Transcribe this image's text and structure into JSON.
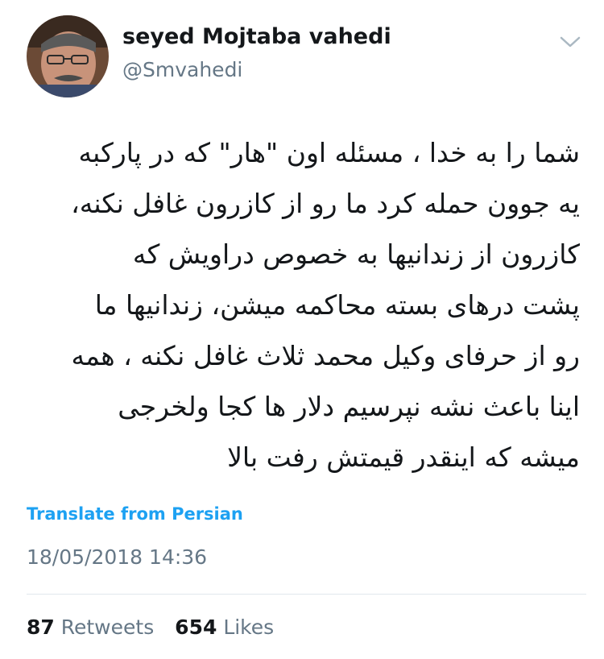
{
  "user": {
    "display_name": "seyed Mojtaba vahedi",
    "handle": "@Smvahedi"
  },
  "tweet": {
    "lines": [
      "شما را به خدا ، مسئله اون \"هار\" که در پارکبه",
      "یه جوون حمله کرد ما رو از کازرون غافل نکنه،",
      "کازرون از زندانیها به خصوص دراویش که",
      "پشت درهای بسته محاکمه میشن، زندانیها ما",
      "رو از حرفای وکیل محمد ثلاث غافل نکنه ، همه",
      "اینا باعث نشه نپرسیم دلار ها کجا ولخرجی",
      "میشه که اینقدر قیمتش رفت بالا"
    ],
    "translate_label": "Translate from Persian",
    "timestamp": "18/05/2018 14:36"
  },
  "stats": {
    "retweets_count": "87",
    "retweets_label": "Retweets",
    "likes_count": "654",
    "likes_label": "Likes"
  },
  "icons": {
    "menu": "chevron-down-icon"
  },
  "colors": {
    "link": "#1da1f2",
    "secondary_text": "#657786",
    "primary_text": "#14171a",
    "divider": "#e1e8ed"
  }
}
